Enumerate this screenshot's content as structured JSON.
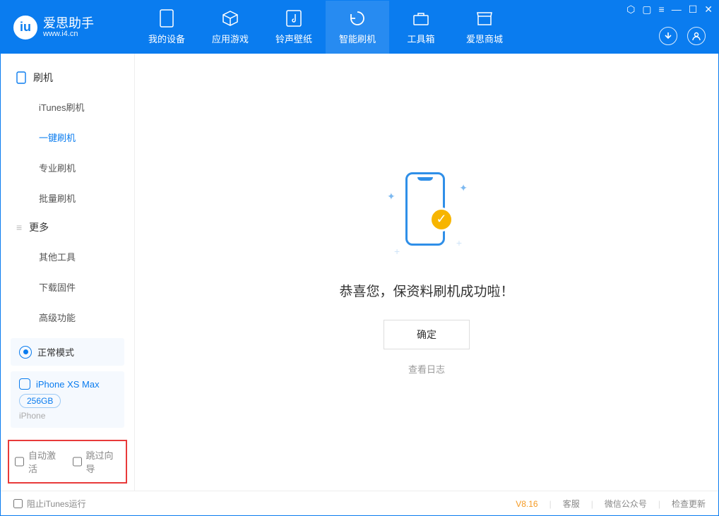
{
  "header": {
    "app_title": "爱思助手",
    "app_url": "www.i4.cn",
    "tabs": [
      {
        "label": "我的设备"
      },
      {
        "label": "应用游戏"
      },
      {
        "label": "铃声壁纸"
      },
      {
        "label": "智能刷机"
      },
      {
        "label": "工具箱"
      },
      {
        "label": "爱思商城"
      }
    ],
    "active_tab_index": 3
  },
  "sidebar": {
    "group1_title": "刷机",
    "group1_items": [
      {
        "label": "iTunes刷机"
      },
      {
        "label": "一键刷机"
      },
      {
        "label": "专业刷机"
      },
      {
        "label": "批量刷机"
      }
    ],
    "group1_active_index": 1,
    "group2_title": "更多",
    "group2_items": [
      {
        "label": "其他工具"
      },
      {
        "label": "下载固件"
      },
      {
        "label": "高级功能"
      }
    ],
    "mode_label": "正常模式",
    "device": {
      "name": "iPhone XS Max",
      "capacity": "256GB",
      "type": "iPhone"
    },
    "options": {
      "auto_activate": "自动激活",
      "skip_guide": "跳过向导"
    }
  },
  "main": {
    "success_text": "恭喜您，保资料刷机成功啦！",
    "ok_label": "确定",
    "log_link": "查看日志"
  },
  "footer": {
    "block_itunes": "阻止iTunes运行",
    "version": "V8.16",
    "links": [
      "客服",
      "微信公众号",
      "检查更新"
    ]
  }
}
